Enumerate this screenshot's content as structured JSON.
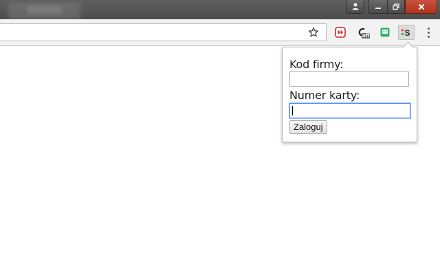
{
  "window": {
    "controls": {
      "profile_icon": "person-icon",
      "minimize_icon": "minimize-icon",
      "maximize_icon": "restore-icon",
      "close_icon": "close-icon"
    }
  },
  "toolbar": {
    "address_value": "",
    "bookmark_icon": "star-icon",
    "extensions": [
      {
        "icon": "red-double-arrow-extension-icon",
        "accent": "#c62828"
      },
      {
        "icon": "c-off-extension-icon",
        "badge": "off"
      },
      {
        "icon": "green-face-extension-icon",
        "accent": "#2bb673"
      },
      {
        "icon": "s-dots-extension-icon",
        "label": "S"
      }
    ],
    "menu_icon": "more-vertical-icon"
  },
  "popup": {
    "company_code_label": "Kod firmy:",
    "company_code_value": "",
    "card_number_label": "Numer karty:",
    "card_number_value": "",
    "submit_label": "Zaloguj",
    "focus_color": "#4d90fe"
  }
}
